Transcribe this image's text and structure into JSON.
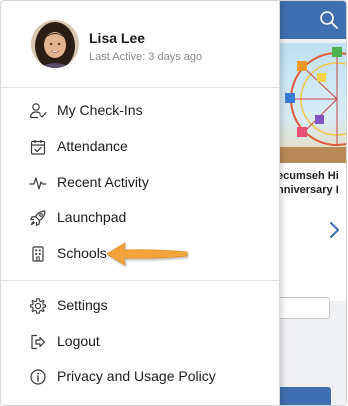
{
  "profile": {
    "name": "Lisa Lee",
    "last_active": "Last Active: 3 days ago"
  },
  "menu": {
    "primary": [
      {
        "label": "My Check-Ins",
        "icon": "user-check-icon"
      },
      {
        "label": "Attendance",
        "icon": "calendar-check-icon"
      },
      {
        "label": "Recent Activity",
        "icon": "activity-pulse-icon"
      },
      {
        "label": "Launchpad",
        "icon": "rocket-icon"
      },
      {
        "label": "Schools",
        "icon": "building-icon"
      }
    ],
    "secondary": [
      {
        "label": "Settings",
        "icon": "gear-icon"
      },
      {
        "label": "Logout",
        "icon": "logout-icon"
      },
      {
        "label": "Privacy and Usage Policy",
        "icon": "info-icon"
      }
    ]
  },
  "background": {
    "card_title_line1": "ecumseh Hi",
    "card_title_line2": "nniversary I"
  },
  "colors": {
    "header_blue": "#3f6fb1",
    "arrow_orange": "#f2a33a",
    "icon_gray": "#3a3a3c"
  }
}
